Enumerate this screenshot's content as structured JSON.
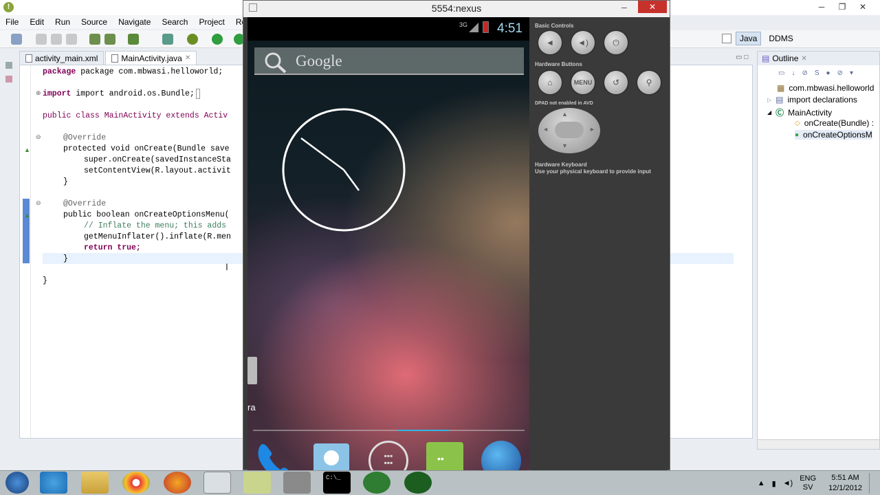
{
  "eclipse": {
    "menu": [
      "File",
      "Edit",
      "Run",
      "Source",
      "Navigate",
      "Search",
      "Project",
      "Refactor"
    ],
    "tabs": [
      {
        "label": "activity_main.xml"
      },
      {
        "label": "MainActivity.java",
        "close": "✕"
      }
    ],
    "code": [
      "package com.mbwasi.helloworld;",
      "import android.os.Bundle;",
      "public class MainActivity extends Activ",
      "@Override",
      "protected void onCreate(Bundle save",
      "super.onCreate(savedInstanceSta",
      "setContentView(R.layout.activit",
      "}",
      "@Override",
      "public boolean onCreateOptionsMenu(",
      "// Inflate the menu; this adds",
      "getMenuInflater().inflate(R.men",
      "return true;",
      "}",
      "}"
    ],
    "perspectives": [
      "Java",
      "DDMS"
    ],
    "outline": {
      "title": "Outline",
      "items": [
        "com.mbwasi.helloworld",
        "import declarations",
        "MainActivity",
        "onCreate(Bundle) :",
        "onCreateOptionsM"
      ]
    }
  },
  "emulator": {
    "title": "5554:nexus",
    "status": {
      "network": "3G",
      "time": "4:51"
    },
    "search_label": "Google",
    "partial_label": "ra",
    "controls": {
      "basic": "Basic Controls",
      "hardware": "Hardware Buttons",
      "menu_btn": "MENU",
      "dpad": "DPAD not enabled in AVD",
      "keyboard_title": "Hardware Keyboard",
      "keyboard_text": "Use your physical keyboard to provide input"
    }
  },
  "taskbar": {
    "lang": "ENG",
    "region": "SV",
    "time": "5:51 AM",
    "date": "12/1/2012",
    "console_text": "C:\\_"
  }
}
